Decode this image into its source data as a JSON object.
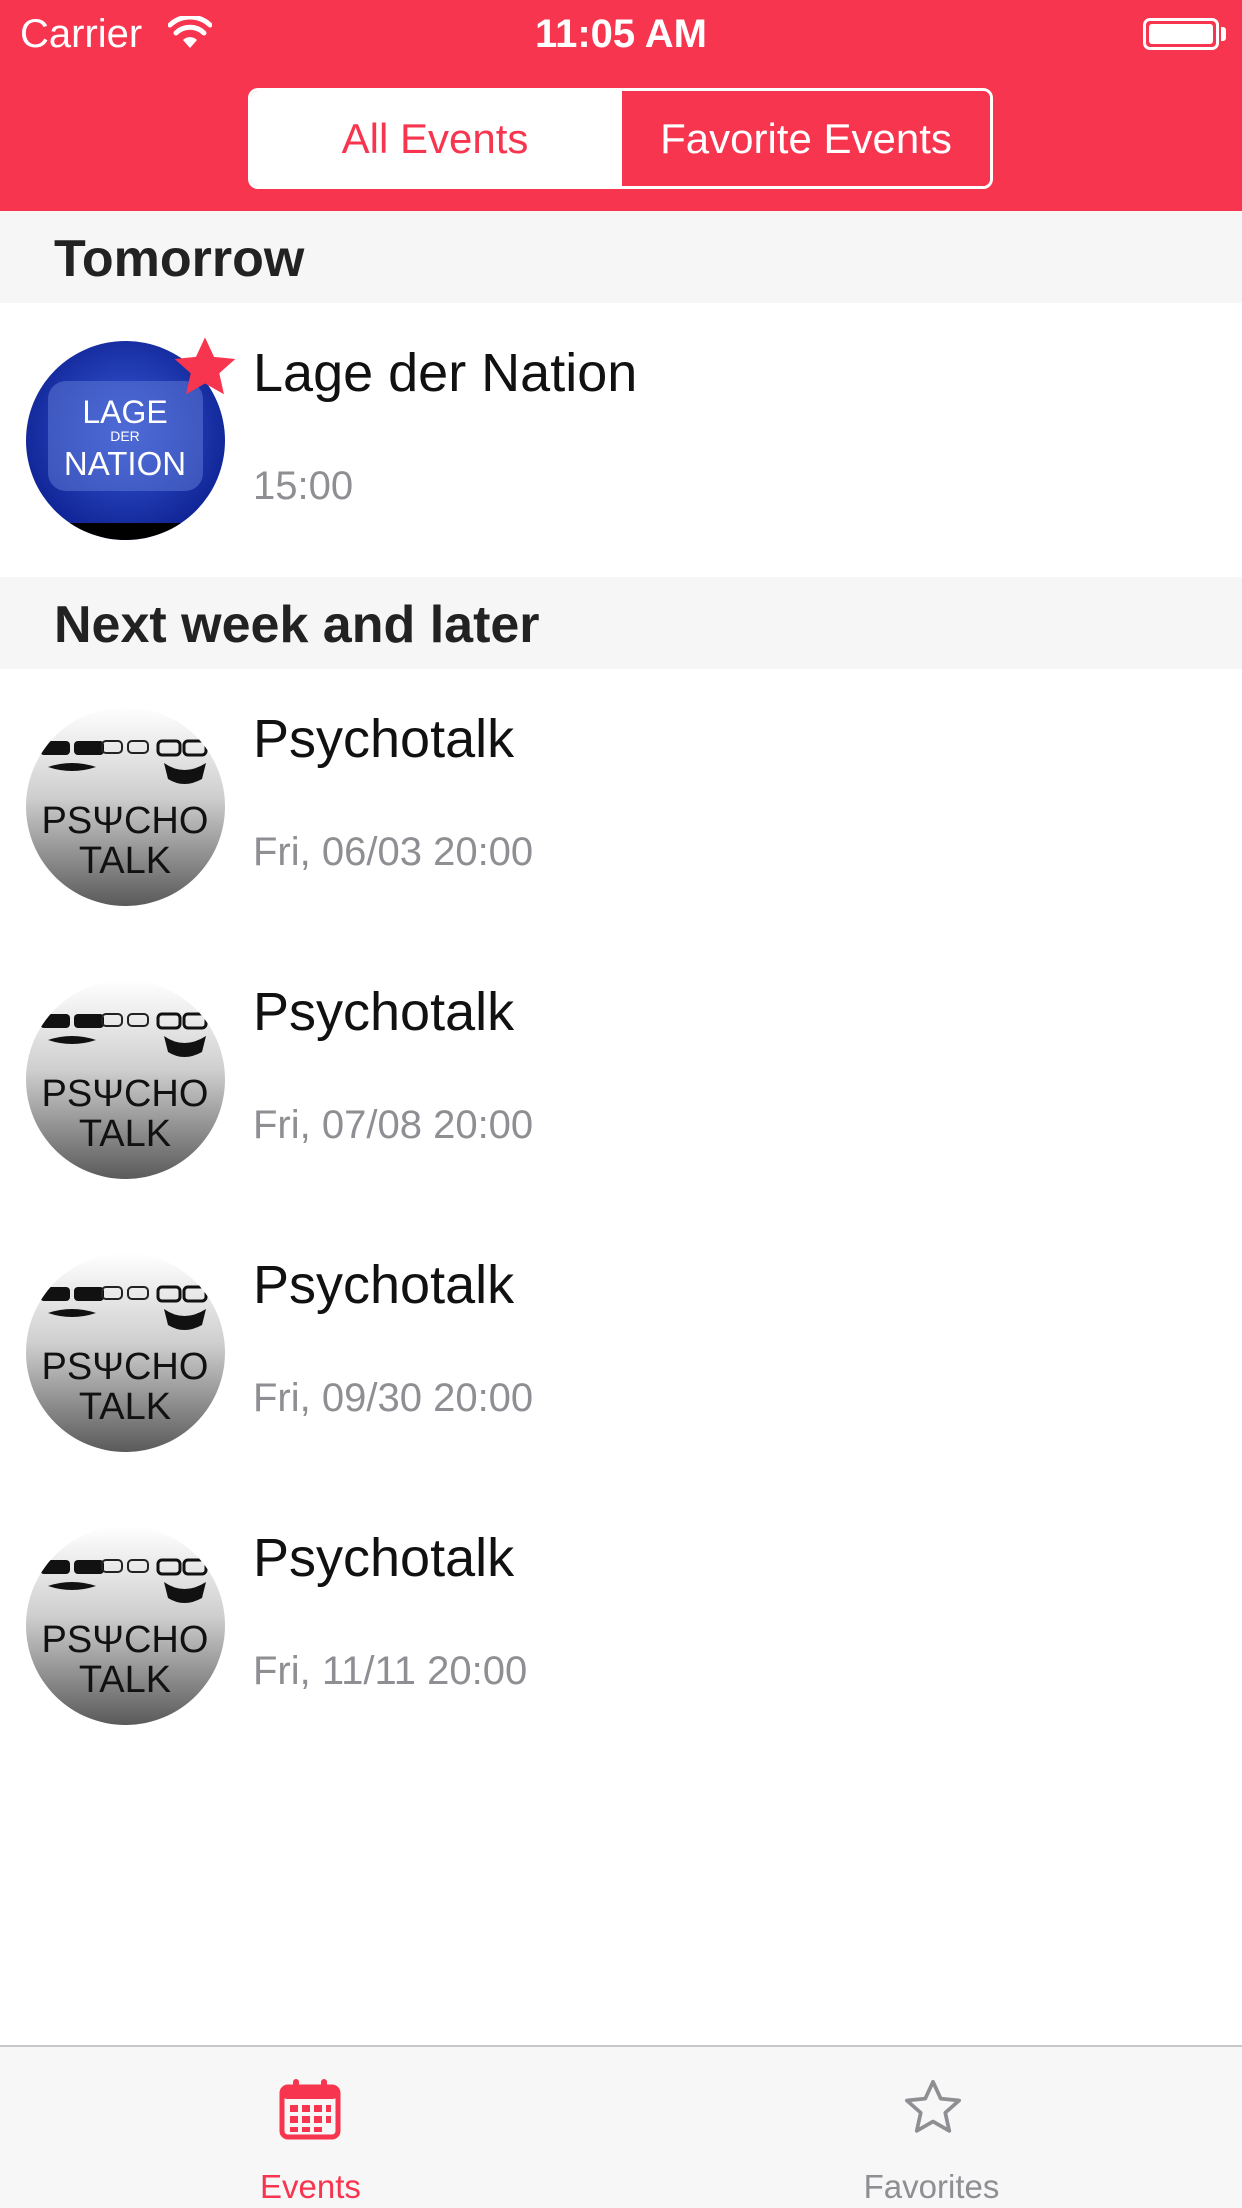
{
  "status_bar": {
    "carrier": "Carrier",
    "time": "11:05 AM"
  },
  "segmented_control": {
    "all_events": "All Events",
    "favorite_events": "Favorite Events",
    "selected": "all_events"
  },
  "sections": [
    {
      "title": "Tomorrow",
      "rows": [
        {
          "title": "Lage der Nation",
          "time": "15:00",
          "favorite": true,
          "logo_top": "LAGE",
          "logo_mid": "DER",
          "logo_bottom": "NATION"
        }
      ]
    },
    {
      "title": "Next week and later",
      "rows": [
        {
          "title": "Psychotalk",
          "time": "Fri, 06/03 20:00",
          "favorite": false,
          "logo_top": "PSΨCHO",
          "logo_bottom": "TALK"
        },
        {
          "title": "Psychotalk",
          "time": "Fri, 07/08 20:00",
          "favorite": false,
          "logo_top": "PSΨCHO",
          "logo_bottom": "TALK"
        },
        {
          "title": "Psychotalk",
          "time": "Fri, 09/30 20:00",
          "favorite": false,
          "logo_top": "PSΨCHO",
          "logo_bottom": "TALK"
        },
        {
          "title": "Psychotalk",
          "time": "Fri, 11/11 20:00",
          "favorite": false,
          "logo_top": "PSΨCHO",
          "logo_bottom": "TALK"
        }
      ]
    }
  ],
  "tab_bar": {
    "events": "Events",
    "favorites": "Favorites",
    "active": "events"
  },
  "colors": {
    "accent": "#f7354f",
    "secondary_text": "#8e8e93",
    "section_bg": "#f6f6f6"
  },
  "icons": {
    "wifi": "wifi-icon",
    "battery": "battery-icon",
    "favorite_badge": "star-filled-icon",
    "events_tab": "calendar-icon",
    "favorites_tab": "star-outline-icon"
  }
}
